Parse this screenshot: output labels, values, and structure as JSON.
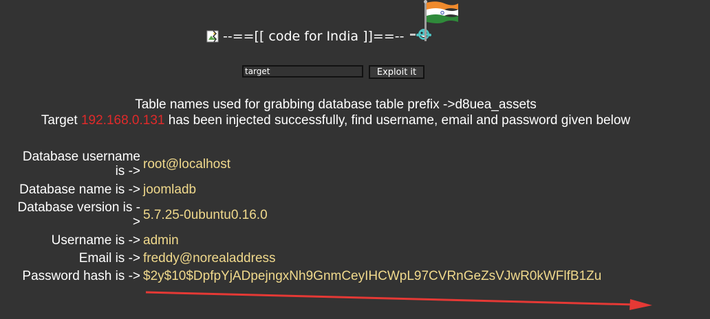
{
  "header": {
    "title": "--==[[ code for India ]]==--"
  },
  "form": {
    "target_value": "target",
    "exploit_label": "Exploit it"
  },
  "messages": {
    "prefix_line": "Table names used for grabbing database table prefix ->d8uea_assets",
    "target_pre": "Target ",
    "target_ip": "192.168.0.131",
    "target_post": " has been injected successfully, find username, email and password given below"
  },
  "results": [
    {
      "label": "Database username is ->",
      "value": "root@localhost"
    },
    {
      "label": "Database name is ->",
      "value": "joomladb"
    },
    {
      "label": "Database version is ->",
      "value": "5.7.25-0ubuntu0.16.0"
    },
    {
      "label": "Username is ->",
      "value": "admin"
    },
    {
      "label": "Email is ->",
      "value": "freddy@norealaddress"
    },
    {
      "label": "Password hash is ->",
      "value": "$2y$10$DpfpYjADpejngxNh9GnmCeyIHCWpL97CVRnGeZsVJwR0kWFlfB1Zu"
    }
  ],
  "colors": {
    "background": "#333333",
    "ip": "#e02a2a",
    "value": "#f0d98c",
    "arrow": "#e53935"
  },
  "icons": {
    "broken_image": "broken-image-icon",
    "flag": "india-flag-icon",
    "smiley": "smiley-icon"
  }
}
